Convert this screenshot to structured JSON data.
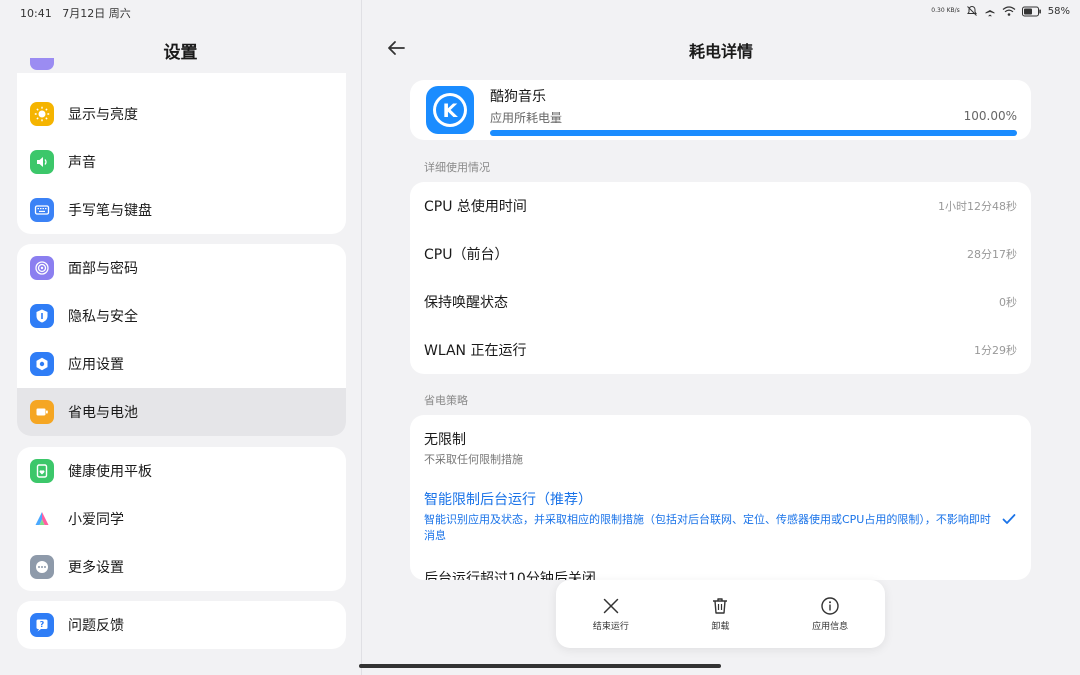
{
  "status": {
    "time": "10:41",
    "date": "7月12日 周六",
    "net_speed": "0.30 KB/s",
    "battery": "58%"
  },
  "left": {
    "title": "设置",
    "groups": [
      [
        {
          "label": "显示与亮度",
          "icon": "sun-icon",
          "color": "#f5b400"
        },
        {
          "label": "声音",
          "icon": "speaker-icon",
          "color": "#3cc76a"
        },
        {
          "label": "手写笔与键盘",
          "icon": "keyboard-icon",
          "color": "#3b82f6"
        }
      ],
      [
        {
          "label": "面部与密码",
          "icon": "face-icon",
          "color": "#8b7ff0"
        },
        {
          "label": "隐私与安全",
          "icon": "shield-icon",
          "color": "#2f7df6"
        },
        {
          "label": "应用设置",
          "icon": "hexagon-icon",
          "color": "#2f7df6"
        },
        {
          "label": "省电与电池",
          "icon": "battery-icon",
          "color": "#f5a623"
        }
      ],
      [
        {
          "label": "健康使用平板",
          "icon": "health-icon",
          "color": "#3cc76a"
        },
        {
          "label": "小爱同学",
          "icon": "assistant-icon",
          "color": "#ffffff"
        },
        {
          "label": "更多设置",
          "icon": "more-icon",
          "color": "#8e9aaa"
        }
      ],
      [
        {
          "label": "问题反馈",
          "icon": "feedback-icon",
          "color": "#2f7df6"
        }
      ]
    ]
  },
  "right": {
    "title": "耗电详情",
    "app": {
      "name": "酷狗音乐",
      "sub": "应用所耗电量",
      "percent_text": "100.00%",
      "percent": 100
    },
    "usage_section": "详细使用情况",
    "usage": [
      {
        "key": "CPU 总使用时间",
        "value": "1小时12分48秒"
      },
      {
        "key": "CPU（前台）",
        "value": "28分17秒"
      },
      {
        "key": "保持唤醒状态",
        "value": "0秒"
      },
      {
        "key": "WLAN 正在运行",
        "value": "1分29秒"
      }
    ],
    "policy_section": "省电策略",
    "policy": [
      {
        "title": "无限制",
        "desc": "不采取任何限制措施"
      },
      {
        "title": "智能限制后台运行（推荐）",
        "desc": "智能识别应用及状态，并采取相应的限制措施（包括对后台联网、定位、传感器使用或CPU占用的限制），不影响即时消息"
      },
      {
        "title": "后台运行超过10分钟后关闭",
        "desc": ""
      }
    ],
    "actions": [
      {
        "label": "结束运行",
        "icon": "close-icon"
      },
      {
        "label": "卸载",
        "icon": "trash-icon"
      },
      {
        "label": "应用信息",
        "icon": "info-icon"
      }
    ]
  }
}
